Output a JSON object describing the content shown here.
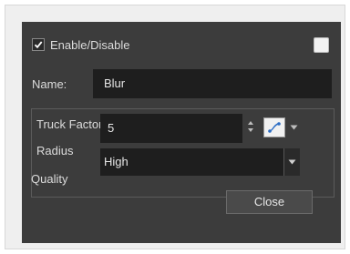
{
  "enable": {
    "label": "Enable/Disable",
    "checked": true
  },
  "color_swatch": {
    "color": "#f2f2f2"
  },
  "name": {
    "label": "Name:",
    "value": "Blur"
  },
  "truck_factor": {
    "label": "Truck Factor",
    "checked": true
  },
  "radius": {
    "label": "Radius",
    "value": "5"
  },
  "quality": {
    "label": "Quality",
    "value": "High"
  },
  "close_button": {
    "label": "Close"
  }
}
